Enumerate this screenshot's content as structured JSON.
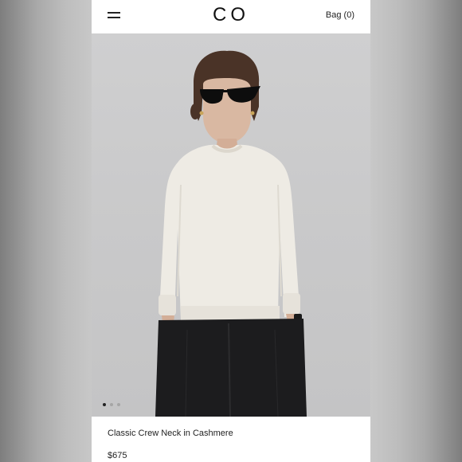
{
  "header": {
    "menu_icon": "hamburger-menu-icon",
    "logo": "CO",
    "bag_label": "Bag (0)"
  },
  "hero": {
    "image_alt": "",
    "carousel": {
      "total": 3,
      "active_index": 0
    }
  },
  "product": {
    "name": "Classic Crew Neck in Cashmere",
    "price": "$675"
  },
  "colors": {
    "background": "#ffffff",
    "text": "#222222",
    "photo_bg": "#c9c9ca",
    "sweater": "#eeebe4",
    "trousers": "#1c1c1e"
  }
}
